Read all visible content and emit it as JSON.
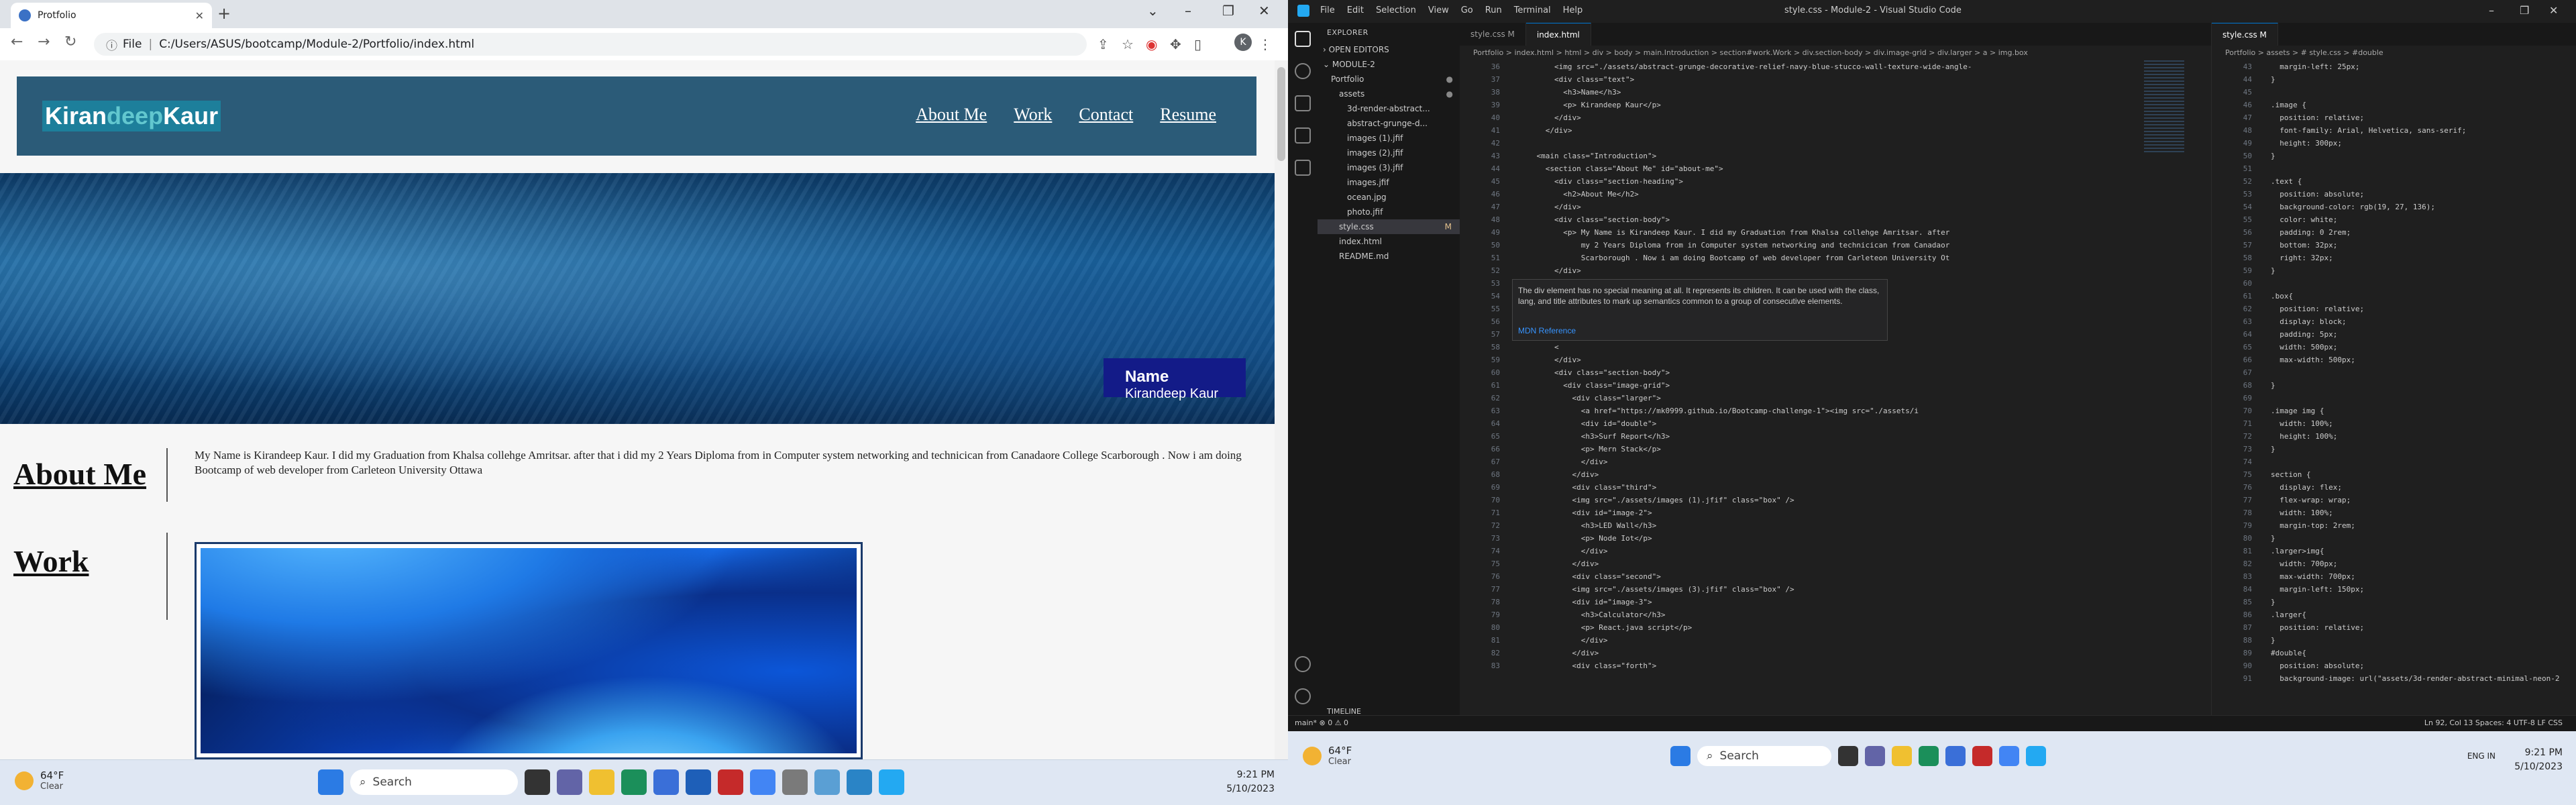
{
  "browser": {
    "tab_title": "Protfolio",
    "address": "C:/Users/ASUS/bootcamp/Module-2/Portfolio/index.html",
    "address_label": "File",
    "profile_initial": "K"
  },
  "site": {
    "logo_part1": "Kiran",
    "logo_part2": "deep",
    "logo_part3": "Kaur",
    "nav": [
      "About Me",
      "Work",
      "Contact",
      "Resume"
    ],
    "hero_name_title": "Name",
    "hero_name_value": "Kirandeep Kaur",
    "about_heading": "About Me",
    "about_text": "My Name is Kirandeep Kaur. I did my Graduation from Khalsa collehge Amritsar. after that i did my 2 Years Diploma from in Computer system networking and technicican from Canadaore College Scarborough . Now i am doing Bootcamp of web developer from Carleteon University Ottawa",
    "work_heading": "Work"
  },
  "taskbar": {
    "weather_temp": "64°F",
    "weather_desc": "Clear",
    "search_label": "Search",
    "time": "9:21 PM",
    "date": "5/10/2023"
  },
  "vscode": {
    "menu": [
      "File",
      "Edit",
      "Selection",
      "View",
      "Go",
      "Run",
      "Terminal",
      "Help"
    ],
    "window_title": "style.css - Module-2 - Visual Studio Code",
    "explorer_label": "EXPLORER",
    "open_editors": "OPEN EDITORS",
    "workspace": "MODULE-2",
    "tree": [
      {
        "name": "Portfolio",
        "indent": 1,
        "dot": true
      },
      {
        "name": "assets",
        "indent": 2,
        "dot": true
      },
      {
        "name": "3d-render-abstract...",
        "indent": 3
      },
      {
        "name": "abstract-grunge-d...",
        "indent": 3
      },
      {
        "name": "images (1).jfif",
        "indent": 3
      },
      {
        "name": "images (2).jfif",
        "indent": 3
      },
      {
        "name": "images (3).jfif",
        "indent": 3
      },
      {
        "name": "images.jfif",
        "indent": 3
      },
      {
        "name": "ocean.jpg",
        "indent": 3
      },
      {
        "name": "photo.jfif",
        "indent": 3
      },
      {
        "name": "style.css",
        "indent": 2,
        "badge": "M",
        "selected": true
      },
      {
        "name": "index.html",
        "indent": 2
      },
      {
        "name": "README.md",
        "indent": 2
      }
    ],
    "timeline": "TIMELINE",
    "tabs_left": [
      "style.css M",
      "index.html"
    ],
    "breadcrumb_left": "Portfolio > index.html > html > div > body > main.Introduction > section#work.Work > div.section-body > div.image-grid > div.larger > a > img.box",
    "html_lines": [
      {
        "n": "36",
        "t": "        <img src=\"./assets/abstract-grunge-decorative-relief-navy-blue-stucco-wall-texture-wide-angle-"
      },
      {
        "n": "37",
        "t": "        <div class=\"text\">"
      },
      {
        "n": "38",
        "t": "          <h3>Name</h3>"
      },
      {
        "n": "39",
        "t": "          <p> Kirandeep Kaur</p>"
      },
      {
        "n": "40",
        "t": "        </div>"
      },
      {
        "n": "41",
        "t": "      </div>"
      },
      {
        "n": "42",
        "t": ""
      },
      {
        "n": "43",
        "t": "    <main class=\"Introduction\">"
      },
      {
        "n": "44",
        "t": "      <section class=\"About Me\" id=\"about-me\">"
      },
      {
        "n": "45",
        "t": "        <div class=\"section-heading\">"
      },
      {
        "n": "46",
        "t": "          <h2>About Me</h2>"
      },
      {
        "n": "47",
        "t": "        </div>"
      },
      {
        "n": "48",
        "t": "        <div class=\"section-body\">"
      },
      {
        "n": "49",
        "t": "          <p> My Name is Kirandeep Kaur. I did my Graduation from Khalsa collehge Amritsar. after"
      },
      {
        "n": "50",
        "t": "              my 2 Years Diploma from in Computer system networking and technicican from Canadaor"
      },
      {
        "n": "51",
        "t": "              Scarborough . Now i am doing Bootcamp of web developer from Carleteon University Ot"
      },
      {
        "n": "52",
        "t": "        </div>"
      },
      {
        "n": "53",
        "t": "      </section>"
      },
      {
        "n": "54",
        "t": ""
      },
      {
        "n": "55",
        "t": "      <sect"
      },
      {
        "n": "56",
        "t": "        <"
      },
      {
        "n": "57",
        "t": ""
      },
      {
        "n": "58",
        "t": "        <"
      },
      {
        "n": "59",
        "t": "        </div>"
      },
      {
        "n": "60",
        "t": "        <div class=\"section-body\">"
      },
      {
        "n": "61",
        "t": "          <div class=\"image-grid\">"
      },
      {
        "n": "62",
        "t": "            <div class=\"larger\">"
      },
      {
        "n": "63",
        "t": "              <a href=\"https://mk0999.github.io/Bootcamp-challenge-1\"><img src=\"./assets/i"
      },
      {
        "n": "64",
        "t": "              <div id=\"double\">"
      },
      {
        "n": "65",
        "t": "              <h3>Surf Report</h3>"
      },
      {
        "n": "66",
        "t": "              <p> Mern Stack</p>"
      },
      {
        "n": "67",
        "t": "              </div>"
      },
      {
        "n": "68",
        "t": "            </div>"
      },
      {
        "n": "69",
        "t": "            <div class=\"third\">"
      },
      {
        "n": "70",
        "t": "            <img src=\"./assets/images (1).jfif\" class=\"box\" />"
      },
      {
        "n": "71",
        "t": "            <div id=\"image-2\">"
      },
      {
        "n": "72",
        "t": "              <h3>LED Wall</h3>"
      },
      {
        "n": "73",
        "t": "              <p> Node Iot</p>"
      },
      {
        "n": "74",
        "t": "              </div>"
      },
      {
        "n": "75",
        "t": "            </div>"
      },
      {
        "n": "76",
        "t": "            <div class=\"second\">"
      },
      {
        "n": "77",
        "t": "            <img src=\"./assets/images (3).jfif\" class=\"box\" />"
      },
      {
        "n": "78",
        "t": "            <div id=\"image-3\">"
      },
      {
        "n": "79",
        "t": "              <h3>Calculator</h3>"
      },
      {
        "n": "80",
        "t": "              <p> React.java script</p>"
      },
      {
        "n": "81",
        "t": "              </div>"
      },
      {
        "n": "82",
        "t": "            </div>"
      },
      {
        "n": "83",
        "t": "            <div class=\"forth\">"
      }
    ],
    "hover_text": "The div element has no special meaning at all. It represents its children. It can be used with the class, lang, and title attributes to mark up semantics common to a group of consecutive elements.",
    "hover_ref": "MDN Reference",
    "tab_right": "style.css M",
    "breadcrumb_right": "Portfolio > assets > # style.css > #double",
    "css_lines": [
      {
        "n": "43",
        "t": "  margin-left: 25px;"
      },
      {
        "n": "44",
        "t": "}"
      },
      {
        "n": "45",
        "t": ""
      },
      {
        "n": "46",
        "t": ".image {"
      },
      {
        "n": "47",
        "t": "  position: relative;"
      },
      {
        "n": "48",
        "t": "  font-family: Arial, Helvetica, sans-serif;"
      },
      {
        "n": "49",
        "t": "  height: 300px;"
      },
      {
        "n": "50",
        "t": "}"
      },
      {
        "n": "51",
        "t": ""
      },
      {
        "n": "52",
        "t": ".text {"
      },
      {
        "n": "53",
        "t": "  position: absolute;"
      },
      {
        "n": "54",
        "t": "  background-color: rgb(19, 27, 136);"
      },
      {
        "n": "55",
        "t": "  color: white;"
      },
      {
        "n": "56",
        "t": "  padding: 0 2rem;"
      },
      {
        "n": "57",
        "t": "  bottom: 32px;"
      },
      {
        "n": "58",
        "t": "  right: 32px;"
      },
      {
        "n": "59",
        "t": "}"
      },
      {
        "n": "60",
        "t": ""
      },
      {
        "n": "61",
        "t": ".box{"
      },
      {
        "n": "62",
        "t": "  position: relative;"
      },
      {
        "n": "63",
        "t": "  display: block;"
      },
      {
        "n": "64",
        "t": "  padding: 5px;"
      },
      {
        "n": "65",
        "t": "  width: 500px;"
      },
      {
        "n": "66",
        "t": "  max-width: 500px;"
      },
      {
        "n": "67",
        "t": ""
      },
      {
        "n": "68",
        "t": "}"
      },
      {
        "n": "69",
        "t": ""
      },
      {
        "n": "70",
        "t": ".image img {"
      },
      {
        "n": "71",
        "t": "  width: 100%;"
      },
      {
        "n": "72",
        "t": "  height: 100%;"
      },
      {
        "n": "73",
        "t": "}"
      },
      {
        "n": "74",
        "t": ""
      },
      {
        "n": "75",
        "t": "section {"
      },
      {
        "n": "76",
        "t": "  display: flex;"
      },
      {
        "n": "77",
        "t": "  flex-wrap: wrap;"
      },
      {
        "n": "78",
        "t": "  width: 100%;"
      },
      {
        "n": "79",
        "t": "  margin-top: 2rem;"
      },
      {
        "n": "80",
        "t": "}"
      },
      {
        "n": "81",
        "t": ".larger>img{"
      },
      {
        "n": "82",
        "t": "  width: 700px;"
      },
      {
        "n": "83",
        "t": "  max-width: 700px;"
      },
      {
        "n": "84",
        "t": "  margin-left: 150px;"
      },
      {
        "n": "85",
        "t": "}"
      },
      {
        "n": "86",
        "t": ".larger{"
      },
      {
        "n": "87",
        "t": "  position: relative;"
      },
      {
        "n": "88",
        "t": "}"
      },
      {
        "n": "89",
        "t": "#double{"
      },
      {
        "n": "90",
        "t": "  position: absolute;"
      },
      {
        "n": "91",
        "t": "  background-image: url(\"assets/3d-render-abstract-minimal-neon-2"
      }
    ],
    "status_left": "main*  ⊗ 0 ⚠ 0",
    "status_right": "Ln 92, Col 13   Spaces: 4   UTF-8   LF   CSS"
  },
  "taskbar2": {
    "weather_temp": "64°F",
    "weather_desc": "Clear",
    "search_label": "Search",
    "time": "9:21 PM",
    "date": "5/10/2023",
    "lang": "ENG IN"
  }
}
